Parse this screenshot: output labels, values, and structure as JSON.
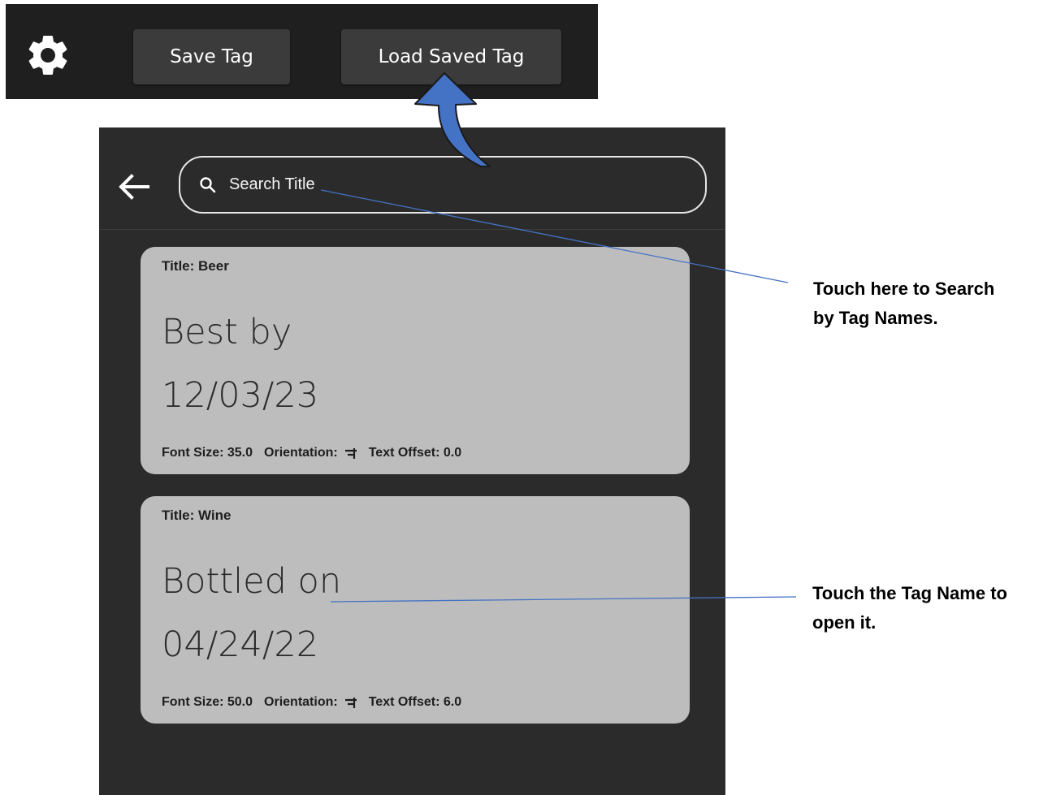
{
  "toolbar": {
    "settings_icon": "gear-icon",
    "save_label": "Save Tag",
    "load_label": "Load Saved Tag"
  },
  "header": {
    "back_icon": "arrow-left-icon",
    "search_placeholder": "Search Title"
  },
  "tags": [
    {
      "title": "Title: Beer",
      "line1": "Best by",
      "line2": "12/03/23",
      "font_size": "Font Size: 35.0",
      "orientation_label": "Orientation:",
      "text_offset": "Text Offset: 0.0"
    },
    {
      "title": "Title: Wine",
      "line1": "Bottled on",
      "line2": "04/24/22",
      "font_size": "Font Size: 50.0",
      "orientation_label": "Orientation:",
      "text_offset": "Text Offset: 6.0"
    }
  ],
  "annotations": {
    "search_callout_line1": "Touch here to Search",
    "search_callout_line2": "by Tag Names.",
    "open_callout_line1": "Touch the Tag Name to",
    "open_callout_line2": "open it."
  },
  "colors": {
    "toolbar_bg": "#1f1f1f",
    "button_bg": "#3b3b3b",
    "panel_bg": "#2b2b2b",
    "card_bg": "#bdbdbd",
    "arrow_fill": "#4472c4",
    "leader_line": "#4472c4"
  }
}
